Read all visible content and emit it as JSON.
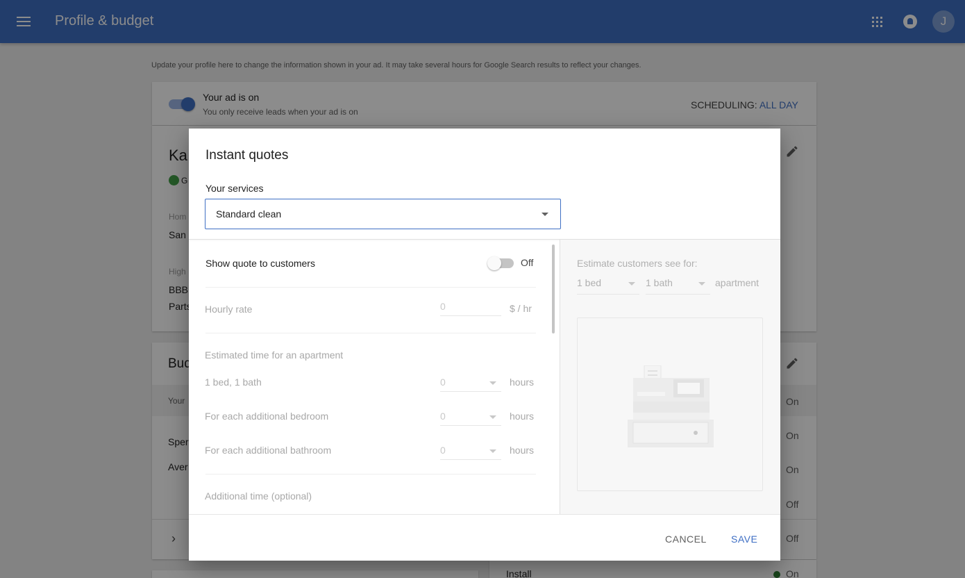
{
  "appbar": {
    "title": "Profile & budget",
    "avatar_initial": "J"
  },
  "intro_text": "Update your profile here to change the information shown in your ad. It may take several hours for Google Search results to reflect your changes.",
  "ad_status": {
    "title": "Your ad is on",
    "subtitle": "You only receive leads when your ad is on",
    "scheduling_label": "SCHEDULING:",
    "scheduling_value": "ALL DAY",
    "on": true
  },
  "profile_card": {
    "name_fragment": "Ka",
    "badge_fragment": "G",
    "home_label_fragment": "Hom",
    "home_value_fragment": "San",
    "highlights_label_fragment": "High",
    "highlight_1_fragment": "BBB",
    "highlight_2_fragment": "Parts"
  },
  "budget_card": {
    "title_fragment": "Bud",
    "row_1_fragment": "Your",
    "row_2_fragment": "Sper",
    "row_3_fragment": "Aver"
  },
  "service_status": [
    {
      "label": "On",
      "color": "#2e7d32"
    },
    {
      "label": "On",
      "color": "#2e7d32"
    },
    {
      "label": "On",
      "color": "#2e7d32"
    },
    {
      "label": "Off",
      "color": "#d32f2f"
    },
    {
      "label": "Off",
      "color": "#d32f2f"
    }
  ],
  "install_row": {
    "label": "Install",
    "status": "On",
    "color": "#2e7d32"
  },
  "dialog": {
    "title": "Instant quotes",
    "services_label": "Your services",
    "selected_service": "Standard clean",
    "show_quote_label": "Show quote to customers",
    "show_quote_state": "Off",
    "show_quote_on": false,
    "hourly_rate_label": "Hourly rate",
    "hourly_rate_value": "0",
    "hourly_rate_unit": "$ / hr",
    "estimated_time_heading": "Estimated time for an apartment",
    "time_rows": [
      {
        "label": "1 bed, 1 bath",
        "value": "0",
        "unit": "hours"
      },
      {
        "label": "For each additional bedroom",
        "value": "0",
        "unit": "hours"
      },
      {
        "label": "For each additional bathroom",
        "value": "0",
        "unit": "hours"
      }
    ],
    "additional_time_heading": "Additional time (optional)",
    "estimate": {
      "label": "Estimate customers see for:",
      "beds": "1 bed",
      "baths": "1 bath",
      "type": "apartment"
    },
    "cancel_label": "CANCEL",
    "save_label": "SAVE"
  }
}
